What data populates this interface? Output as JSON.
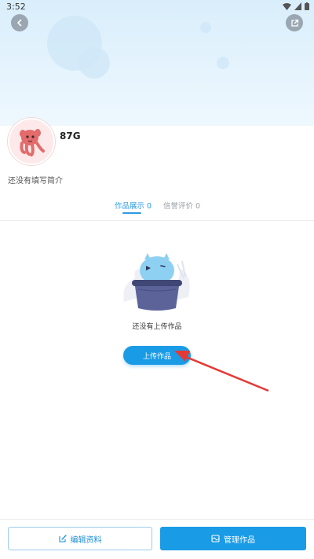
{
  "status_bar": {
    "time": "3:52"
  },
  "profile": {
    "username": "87G",
    "bio": "还没有填写简介"
  },
  "tabs": [
    {
      "label": "作品展示 0",
      "active": true
    },
    {
      "label": "信誉评价 0",
      "active": false
    }
  ],
  "empty_state": {
    "message": "还没有上传作品",
    "upload_button": "上传作品"
  },
  "bottom_bar": {
    "edit_label": "编辑资料",
    "manage_label": "管理作品"
  },
  "colors": {
    "accent": "#1a9be6",
    "header_bg": "#d9eefb",
    "annotation_arrow": "#e53935"
  },
  "icons": [
    "back-icon",
    "share-icon",
    "edit-icon",
    "manage-icon",
    "wifi-icon",
    "signal-icon",
    "battery-icon"
  ]
}
